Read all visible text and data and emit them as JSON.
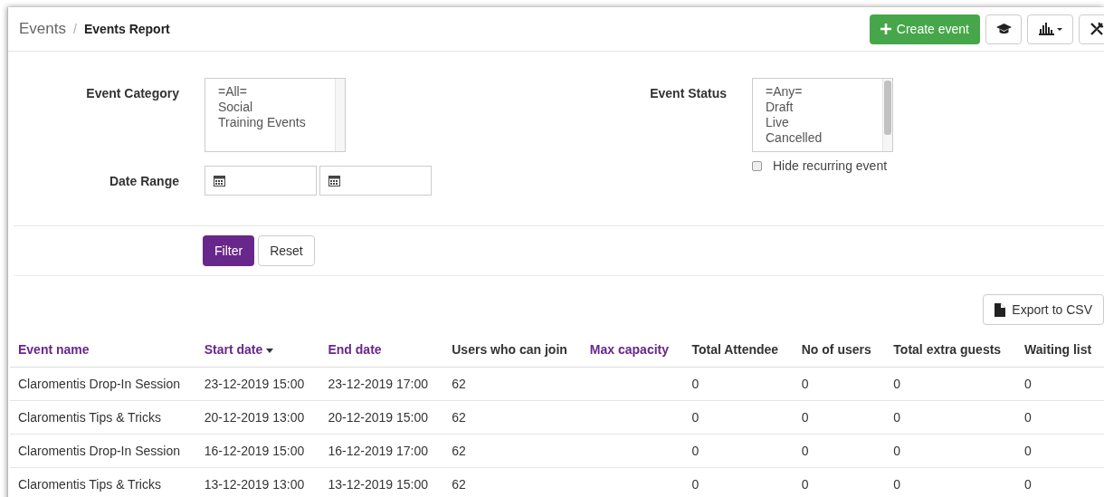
{
  "breadcrumb": {
    "parent": "Events",
    "separator": "/",
    "current": "Events Report"
  },
  "toolbar": {
    "create_button": "Create event"
  },
  "filters": {
    "category": {
      "label": "Event Category",
      "options": [
        "=All=",
        "Social",
        "Training Events"
      ]
    },
    "status": {
      "label": "Event Status",
      "options": [
        "=Any=",
        "Draft",
        "Live",
        "Cancelled"
      ]
    },
    "date_range": {
      "label": "Date Range"
    },
    "hide_recurring": {
      "label": "Hide recurring event",
      "checked": false
    },
    "buttons": {
      "filter": "Filter",
      "reset": "Reset"
    }
  },
  "export_button": "Export to CSV",
  "table": {
    "columns": [
      {
        "label": "Event name",
        "sortable": true,
        "sorted": false
      },
      {
        "label": "Start date",
        "sortable": true,
        "sorted": true
      },
      {
        "label": "End date",
        "sortable": true,
        "sorted": false
      },
      {
        "label": "Users who can join",
        "sortable": false,
        "sorted": false
      },
      {
        "label": "Max capacity",
        "sortable": true,
        "sorted": false
      },
      {
        "label": "Total Attendee",
        "sortable": false,
        "sorted": false
      },
      {
        "label": "No of users",
        "sortable": false,
        "sorted": false
      },
      {
        "label": "Total extra guests",
        "sortable": false,
        "sorted": false
      },
      {
        "label": "Waiting list",
        "sortable": false,
        "sorted": false
      }
    ],
    "rows": [
      [
        "Claromentis Drop-In Session",
        "23-12-2019 15:00",
        "23-12-2019 17:00",
        "62",
        "",
        "0",
        "0",
        "0",
        "0"
      ],
      [
        "Claromentis Tips & Tricks",
        "20-12-2019 13:00",
        "20-12-2019 15:00",
        "62",
        "",
        "0",
        "0",
        "0",
        "0"
      ],
      [
        "Claromentis Drop-In Session",
        "16-12-2019 15:00",
        "16-12-2019 17:00",
        "62",
        "",
        "0",
        "0",
        "0",
        "0"
      ],
      [
        "Claromentis Tips & Tricks",
        "13-12-2019 13:00",
        "13-12-2019 15:00",
        "62",
        "",
        "0",
        "0",
        "0",
        "0"
      ]
    ]
  }
}
